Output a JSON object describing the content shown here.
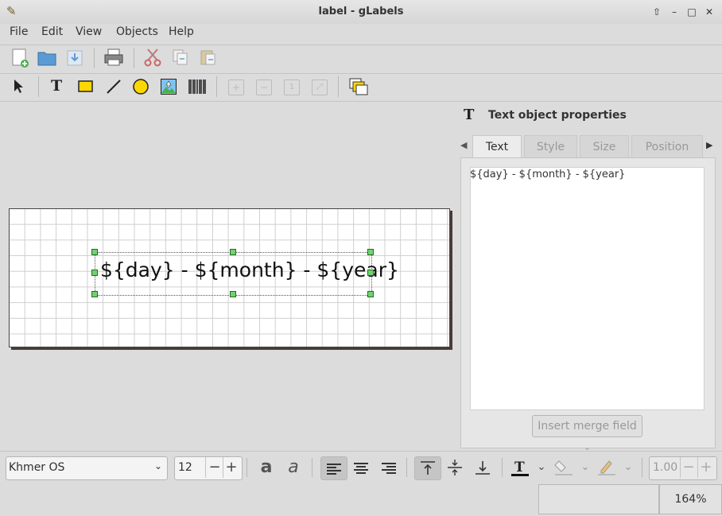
{
  "window": {
    "title": "label - gLabels"
  },
  "menubar": {
    "items": [
      "File",
      "Edit",
      "View",
      "Objects",
      "Help"
    ]
  },
  "canvas": {
    "text": "${day} - ${month} - ${year}"
  },
  "properties": {
    "title": "Text object properties",
    "tabs": [
      "Text",
      "Style",
      "Size",
      "Position"
    ],
    "active_tab": "Text",
    "text_value": "${day} - ${month} - ${year}",
    "merge_button": "Insert merge field"
  },
  "format": {
    "font_family": "Khmer OS",
    "font_size": "12",
    "line_width": "1.00"
  },
  "status": {
    "zoom": "164%"
  },
  "colors": {
    "handle": "#6fd36f",
    "shape_fill": "#ffd700"
  }
}
